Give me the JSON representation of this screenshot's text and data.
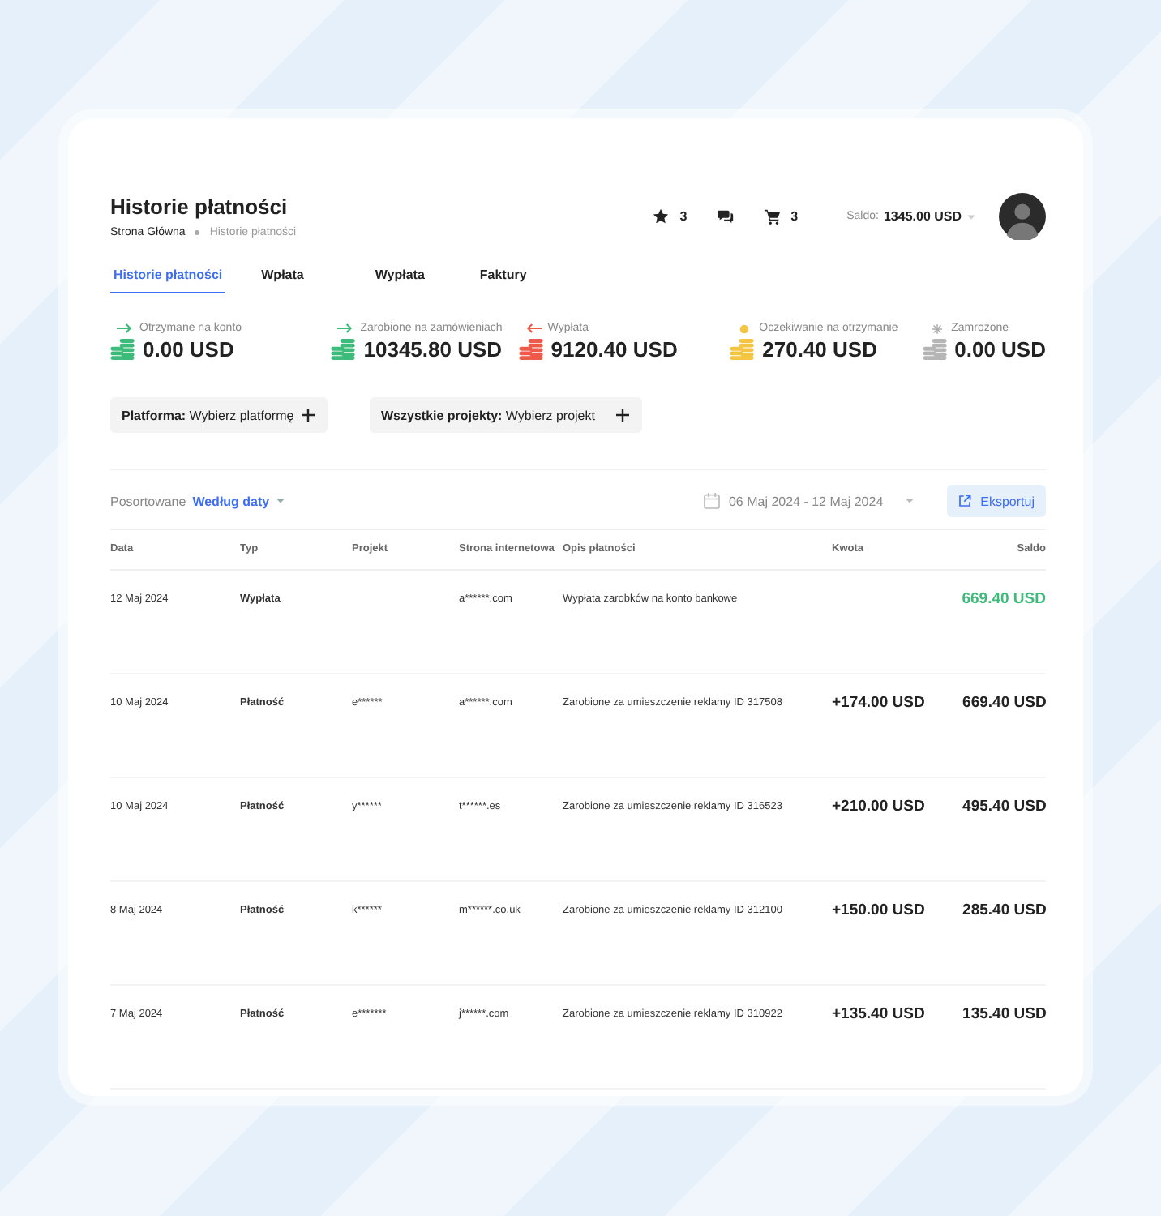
{
  "header": {
    "title": "Historie płatności",
    "breadcrumb": [
      "Strona Główna",
      "Historie płatności"
    ],
    "favorites_count": "3",
    "cart_count": "3",
    "balance_label": "Saldo:",
    "balance_value": "1345.00 USD"
  },
  "tabs": [
    {
      "label": "Historie płatności",
      "selected": true
    },
    {
      "label": "Wpłata",
      "selected": false
    },
    {
      "label": "Wypłata",
      "selected": false
    },
    {
      "label": "Faktury",
      "selected": false
    }
  ],
  "stats": [
    {
      "kind": "in",
      "label": "Otrzymane na konto",
      "value": "0.00 USD",
      "color": "#3dbb7a"
    },
    {
      "kind": "in",
      "label": "Zarobione na zamówieniach",
      "value": "10345.80 USD",
      "color": "#3dbb7a"
    },
    {
      "kind": "out",
      "label": "Wypłata",
      "value": "9120.40 USD",
      "color": "#ee5a4a"
    },
    {
      "kind": "pending",
      "label": "Oczekiwanie na otrzymanie",
      "value": "270.40 USD",
      "color": "#f4c542"
    },
    {
      "kind": "frozen",
      "label": "Zamrożone",
      "value": "0.00 USD",
      "color": "#b5b5b5"
    }
  ],
  "filters": [
    {
      "label": "Platforma:",
      "value": "Wybierz platformę"
    },
    {
      "label": "Wszystkie projekty:",
      "value": "Wybierz projekt"
    }
  ],
  "sort": {
    "label": "Posortowane",
    "value": "Według daty"
  },
  "date_range": "06 Maj 2024 - 12 Maj 2024",
  "export_button": "Eksportuj",
  "table": {
    "columns": [
      "Data",
      "Typ",
      "Projekt",
      "Strona internetowa",
      "Opis płatności",
      "Kwota",
      "Saldo"
    ],
    "rows": [
      {
        "date": "12 Maj 2024",
        "type": "Wypłata",
        "site": "a******.com",
        "description": "Wypłata zarobków na konto bankowe",
        "balance": "669.40 USD",
        "highlight": true
      },
      {
        "date": "10 Maj 2024",
        "type": "Płatność",
        "project": "e******",
        "site": "a******.com",
        "description": "Zarobione za umieszczenie reklamy ID 317508",
        "amount": "+174.00 USD",
        "balance": "669.40 USD",
        "highlight": false
      },
      {
        "date": "10 Maj 2024",
        "type": "Płatność",
        "project": "y******",
        "site": "t******.es",
        "description": "Zarobione za umieszczenie reklamy ID 316523",
        "amount": "+210.00 USD",
        "balance": "495.40 USD",
        "highlight": false
      },
      {
        "date": "8 Maj 2024",
        "type": "Płatność",
        "project": "k******",
        "site": "m******.co.uk",
        "description": "Zarobione za umieszczenie reklamy ID 312100",
        "amount": "+150.00 USD",
        "balance": "285.40 USD",
        "highlight": false
      },
      {
        "date": "7 Maj 2024",
        "type": "Płatność",
        "project": "e*******",
        "site": "j******.com",
        "description": "Zarobione za umieszczenie reklamy ID 310922",
        "amount": "+135.40 USD",
        "balance": "135.40 USD",
        "highlight": false
      }
    ]
  }
}
